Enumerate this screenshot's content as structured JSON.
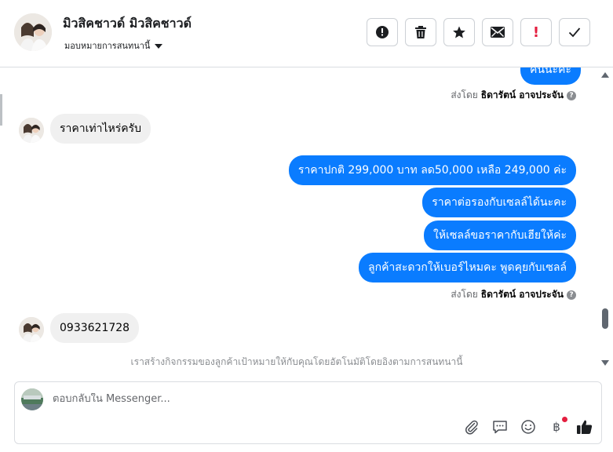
{
  "header": {
    "contact_name": "มิวสิคชาวด์ มิวสิคชาวด์",
    "assign_label": "มอบหมายการสนทนานี้",
    "actions": [
      {
        "name": "mark-spam-button",
        "icon": "alert-circle-icon"
      },
      {
        "name": "delete-button",
        "icon": "trash-icon"
      },
      {
        "name": "star-button",
        "icon": "star-icon"
      },
      {
        "name": "mark-unread-button",
        "icon": "envelope-icon"
      },
      {
        "name": "follow-up-button",
        "icon": "exclamation-icon"
      },
      {
        "name": "done-button",
        "icon": "check-icon"
      }
    ]
  },
  "messages": {
    "partial_out": "ค่นนะคะ",
    "sent_by_prefix": "ส่งโดย",
    "sender_name": "ธิดารัตน์ อาจประจัน",
    "in_1": "ราคาเท่าไหร่ครับ",
    "out_1": "ราคาปกติ  299,000 บาท ลด50,000 เหลือ 249,000 ค่ะ",
    "out_2": "ราคาต่อรองกับเซลล์ได้นะคะ",
    "out_3": "ให้เซลล์ขอราคากับเฮียให้ค่ะ",
    "out_4": "ลูกค้าสะดวกให้เบอร์ไหมคะ พูดคุยกับเซลล์",
    "in_2": "0933621728",
    "system_note": "เราสร้างกิจกรรมของลูกค้าเป้าหมายให้กับคุณโดยอัตโนมัติโดยอิงตามการสนทนานี้"
  },
  "composer": {
    "placeholder": "ตอบกลับใน Messenger...",
    "value": "",
    "tools": [
      "paperclip-icon",
      "saved-reply-icon",
      "emoji-icon",
      "baht-icon",
      "thumbs-up-icon"
    ],
    "baht_symbol": "฿"
  },
  "colors": {
    "outgoing_bubble": "#0a7cff",
    "incoming_bubble": "#f0f0f0",
    "alert_red": "#e41e3f"
  }
}
